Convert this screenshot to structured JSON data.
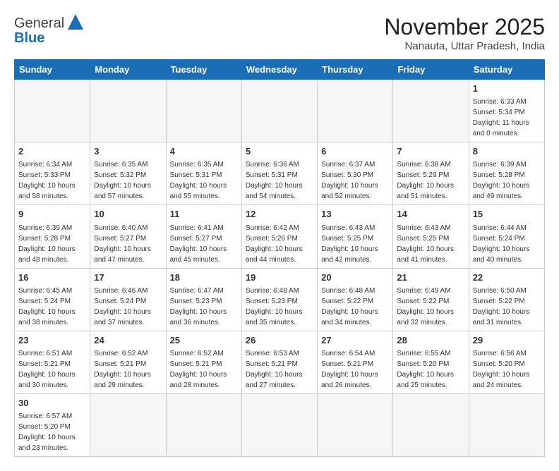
{
  "header": {
    "logo_line1": "General",
    "logo_line2": "Blue",
    "month_title": "November 2025",
    "location": "Nanauta, Uttar Pradesh, India"
  },
  "weekdays": [
    "Sunday",
    "Monday",
    "Tuesday",
    "Wednesday",
    "Thursday",
    "Friday",
    "Saturday"
  ],
  "weeks": [
    [
      {
        "day": "",
        "info": ""
      },
      {
        "day": "",
        "info": ""
      },
      {
        "day": "",
        "info": ""
      },
      {
        "day": "",
        "info": ""
      },
      {
        "day": "",
        "info": ""
      },
      {
        "day": "",
        "info": ""
      },
      {
        "day": "1",
        "info": "Sunrise: 6:33 AM\nSunset: 5:34 PM\nDaylight: 11 hours\nand 0 minutes."
      }
    ],
    [
      {
        "day": "2",
        "info": "Sunrise: 6:34 AM\nSunset: 5:33 PM\nDaylight: 10 hours\nand 58 minutes."
      },
      {
        "day": "3",
        "info": "Sunrise: 6:35 AM\nSunset: 5:32 PM\nDaylight: 10 hours\nand 57 minutes."
      },
      {
        "day": "4",
        "info": "Sunrise: 6:35 AM\nSunset: 5:31 PM\nDaylight: 10 hours\nand 55 minutes."
      },
      {
        "day": "5",
        "info": "Sunrise: 6:36 AM\nSunset: 5:31 PM\nDaylight: 10 hours\nand 54 minutes."
      },
      {
        "day": "6",
        "info": "Sunrise: 6:37 AM\nSunset: 5:30 PM\nDaylight: 10 hours\nand 52 minutes."
      },
      {
        "day": "7",
        "info": "Sunrise: 6:38 AM\nSunset: 5:29 PM\nDaylight: 10 hours\nand 51 minutes."
      },
      {
        "day": "8",
        "info": "Sunrise: 6:39 AM\nSunset: 5:28 PM\nDaylight: 10 hours\nand 49 minutes."
      }
    ],
    [
      {
        "day": "9",
        "info": "Sunrise: 6:39 AM\nSunset: 5:28 PM\nDaylight: 10 hours\nand 48 minutes."
      },
      {
        "day": "10",
        "info": "Sunrise: 6:40 AM\nSunset: 5:27 PM\nDaylight: 10 hours\nand 47 minutes."
      },
      {
        "day": "11",
        "info": "Sunrise: 6:41 AM\nSunset: 5:27 PM\nDaylight: 10 hours\nand 45 minutes."
      },
      {
        "day": "12",
        "info": "Sunrise: 6:42 AM\nSunset: 5:26 PM\nDaylight: 10 hours\nand 44 minutes."
      },
      {
        "day": "13",
        "info": "Sunrise: 6:43 AM\nSunset: 5:25 PM\nDaylight: 10 hours\nand 42 minutes."
      },
      {
        "day": "14",
        "info": "Sunrise: 6:43 AM\nSunset: 5:25 PM\nDaylight: 10 hours\nand 41 minutes."
      },
      {
        "day": "15",
        "info": "Sunrise: 6:44 AM\nSunset: 5:24 PM\nDaylight: 10 hours\nand 40 minutes."
      }
    ],
    [
      {
        "day": "16",
        "info": "Sunrise: 6:45 AM\nSunset: 5:24 PM\nDaylight: 10 hours\nand 38 minutes."
      },
      {
        "day": "17",
        "info": "Sunrise: 6:46 AM\nSunset: 5:24 PM\nDaylight: 10 hours\nand 37 minutes."
      },
      {
        "day": "18",
        "info": "Sunrise: 6:47 AM\nSunset: 5:23 PM\nDaylight: 10 hours\nand 36 minutes."
      },
      {
        "day": "19",
        "info": "Sunrise: 6:48 AM\nSunset: 5:23 PM\nDaylight: 10 hours\nand 35 minutes."
      },
      {
        "day": "20",
        "info": "Sunrise: 6:48 AM\nSunset: 5:22 PM\nDaylight: 10 hours\nand 34 minutes."
      },
      {
        "day": "21",
        "info": "Sunrise: 6:49 AM\nSunset: 5:22 PM\nDaylight: 10 hours\nand 32 minutes."
      },
      {
        "day": "22",
        "info": "Sunrise: 6:50 AM\nSunset: 5:22 PM\nDaylight: 10 hours\nand 31 minutes."
      }
    ],
    [
      {
        "day": "23",
        "info": "Sunrise: 6:51 AM\nSunset: 5:21 PM\nDaylight: 10 hours\nand 30 minutes."
      },
      {
        "day": "24",
        "info": "Sunrise: 6:52 AM\nSunset: 5:21 PM\nDaylight: 10 hours\nand 29 minutes."
      },
      {
        "day": "25",
        "info": "Sunrise: 6:52 AM\nSunset: 5:21 PM\nDaylight: 10 hours\nand 28 minutes."
      },
      {
        "day": "26",
        "info": "Sunrise: 6:53 AM\nSunset: 5:21 PM\nDaylight: 10 hours\nand 27 minutes."
      },
      {
        "day": "27",
        "info": "Sunrise: 6:54 AM\nSunset: 5:21 PM\nDaylight: 10 hours\nand 26 minutes."
      },
      {
        "day": "28",
        "info": "Sunrise: 6:55 AM\nSunset: 5:20 PM\nDaylight: 10 hours\nand 25 minutes."
      },
      {
        "day": "29",
        "info": "Sunrise: 6:56 AM\nSunset: 5:20 PM\nDaylight: 10 hours\nand 24 minutes."
      }
    ],
    [
      {
        "day": "30",
        "info": "Sunrise: 6:57 AM\nSunset: 5:20 PM\nDaylight: 10 hours\nand 23 minutes."
      },
      {
        "day": "",
        "info": ""
      },
      {
        "day": "",
        "info": ""
      },
      {
        "day": "",
        "info": ""
      },
      {
        "day": "",
        "info": ""
      },
      {
        "day": "",
        "info": ""
      },
      {
        "day": "",
        "info": ""
      }
    ]
  ]
}
